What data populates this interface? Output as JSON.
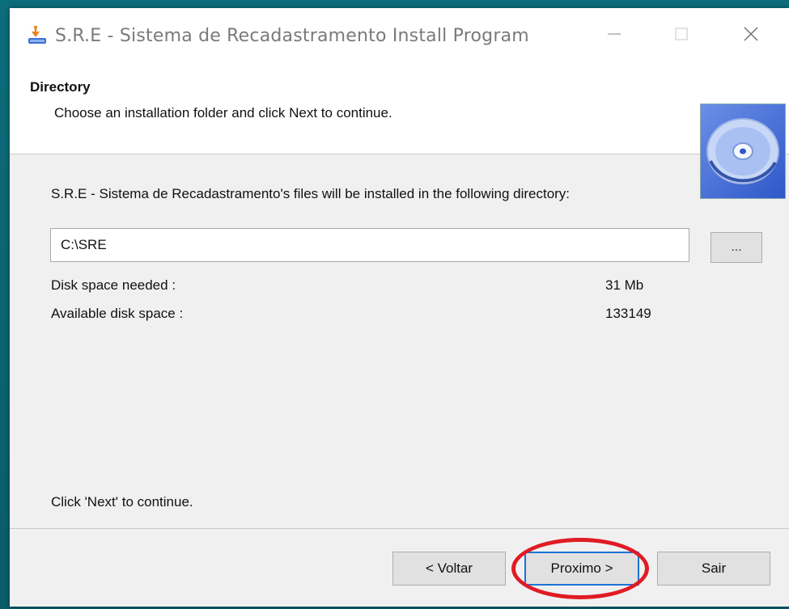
{
  "window": {
    "title": "S.R.E - Sistema de Recadastramento Install Program",
    "controls": {
      "minimize_icon": "minimize-icon",
      "maximize_icon": "maximize-icon",
      "close_icon": "close-icon"
    }
  },
  "header": {
    "title": "Directory",
    "subtitle": "Choose an installation folder and click Next to continue.",
    "icon": "cd-disc-icon"
  },
  "main": {
    "intro": "S.R.E - Sistema de Recadastramento's files will be installed in the following directory:",
    "directory_value": "C:\\SRE",
    "browse_label": "...",
    "disk_needed_label": "Disk space needed :",
    "disk_needed_value": "31 Mb",
    "disk_available_label": "Available disk space :",
    "disk_available_value": "133149",
    "footer_hint": "Click 'Next' to continue."
  },
  "buttons": {
    "back": "< Voltar",
    "next": "Proximo >",
    "exit": "Sair"
  },
  "colors": {
    "highlight": "#e01b24",
    "focus_border": "#1a73d9",
    "desktop": "#0d6c7a"
  }
}
